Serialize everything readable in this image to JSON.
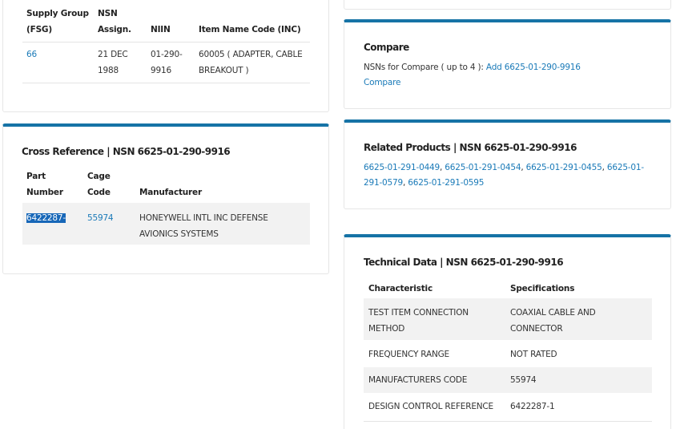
{
  "identification": {
    "headers": [
      "Supply Group (FSG)",
      "NSN Assign.",
      "NIIN",
      "Item Name Code (INC)"
    ],
    "row": {
      "fsg": "66",
      "assigned": "21 DEC 1988",
      "niin": "01-290-9916",
      "inc": "60005 ( ADAPTER, CABLE BREAKOUT )"
    }
  },
  "cross_reference": {
    "title": "Cross Reference | NSN 6625-01-290-9916",
    "headers": [
      "Part Number",
      "Cage Code",
      "Manufacturer"
    ],
    "rows": [
      {
        "part_number": "6422287-1",
        "cage_code": "55974",
        "manufacturer": "HONEYWELL INTL INC DEFENSE AVIONICS SYSTEMS"
      }
    ]
  },
  "compare": {
    "title": "Compare",
    "text": "NSNs for Compare ( up to 4 ):",
    "add_link": "Add 6625-01-290-9916",
    "compare_link": "Compare"
  },
  "related": {
    "title": "Related Products | NSN 6625-01-290-9916",
    "links": [
      "6625-01-291-0449",
      "6625-01-291-0454",
      "6625-01-291-0455",
      "6625-01-291-0579",
      "6625-01-291-0595"
    ]
  },
  "technical": {
    "title": "Technical Data | NSN 6625-01-290-9916",
    "headers": [
      "Characteristic",
      "Specifications"
    ],
    "rows": [
      {
        "characteristic": "TEST ITEM CONNECTION METHOD",
        "specification": "COAXIAL CABLE AND CONNECTOR"
      },
      {
        "characteristic": "FREQUENCY RANGE",
        "specification": "NOT RATED"
      },
      {
        "characteristic": "MANUFACTURERS CODE",
        "specification": "55974"
      },
      {
        "characteristic": "DESIGN CONTROL REFERENCE",
        "specification": "6422287-1"
      }
    ]
  },
  "colors": {
    "accent": "#1673a6",
    "link": "#1a7ab8",
    "selection": "#1767b8"
  }
}
